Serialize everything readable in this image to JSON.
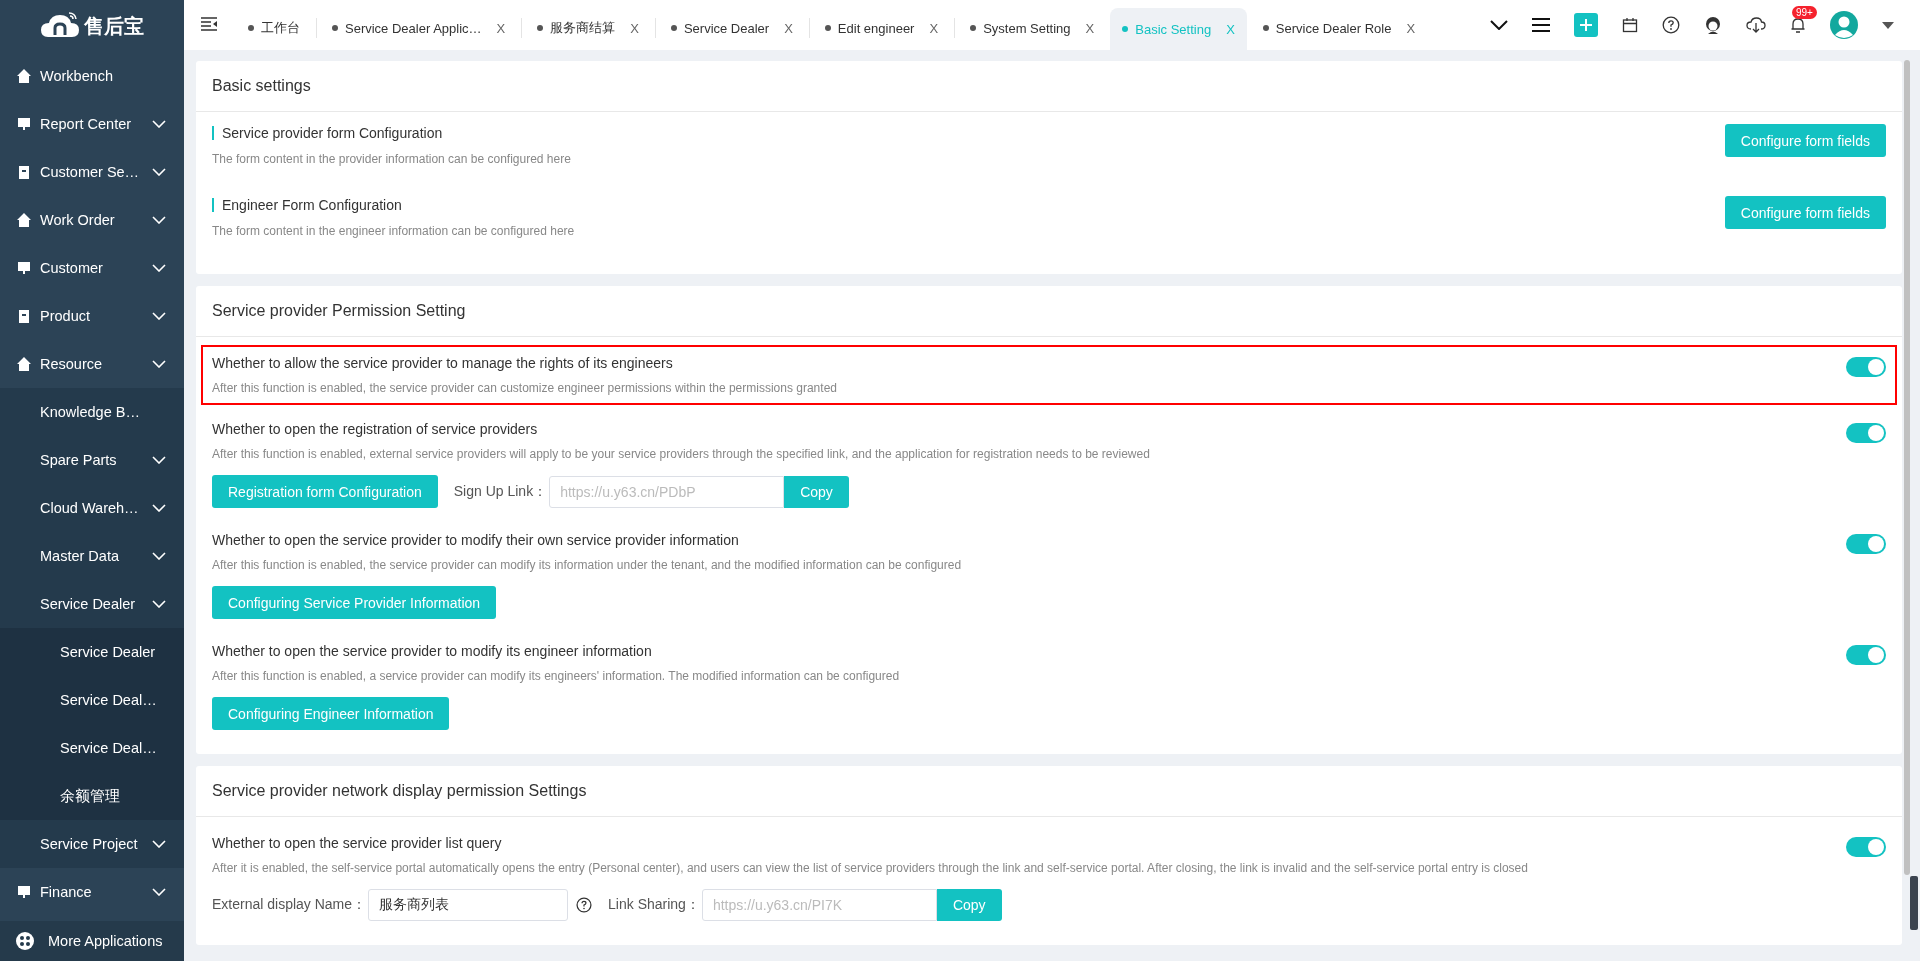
{
  "sidebar": {
    "logo_text": "售后宝",
    "items": [
      {
        "label": "Workbench"
      },
      {
        "label": "Report Center",
        "kind": "group"
      },
      {
        "label": "Customer Se…",
        "kind": "group"
      },
      {
        "label": "Work Order",
        "kind": "group"
      },
      {
        "label": "Customer",
        "kind": "group"
      },
      {
        "label": "Product",
        "kind": "group"
      },
      {
        "label": "Resource",
        "kind": "group",
        "children": [
          {
            "label": "Knowledge B…"
          },
          {
            "label": "Spare Parts",
            "kind": "group"
          },
          {
            "label": "Cloud Wareh…",
            "kind": "group"
          },
          {
            "label": "Master Data",
            "kind": "group"
          },
          {
            "label": "Service Dealer",
            "kind": "group",
            "children": [
              {
                "label": "Service Dealer"
              },
              {
                "label": "Service Deal…"
              },
              {
                "label": "Service Deal…"
              },
              {
                "label": "余额管理"
              }
            ]
          },
          {
            "label": "Service Project",
            "kind": "group"
          }
        ]
      },
      {
        "label": "Finance",
        "kind": "group"
      }
    ],
    "more": "More Applications"
  },
  "tabs": [
    {
      "label": "工作台",
      "selected": false
    },
    {
      "label": "Service Dealer Applic…",
      "selected": false,
      "close": "X"
    },
    {
      "label": "服务商结算",
      "selected": false,
      "close": "X"
    },
    {
      "label": "Service Dealer",
      "selected": false,
      "close": "X"
    },
    {
      "label": "Edit engineer",
      "selected": false,
      "close": "X"
    },
    {
      "label": "System Setting",
      "selected": false,
      "close": "X"
    },
    {
      "label": "Basic Setting",
      "selected": true,
      "close": "X"
    },
    {
      "label": "Service Dealer Role",
      "selected": false,
      "close": "X"
    }
  ],
  "notification_badge": "99+",
  "cards": [
    {
      "title": "Basic settings",
      "rows": [
        {
          "kind": "config",
          "title": "Service provider form Configuration",
          "description": "The form content in the provider information can be configured here",
          "button": "Configure form fields"
        },
        {
          "kind": "config",
          "title": "Engineer Form Configuration",
          "description": "The form content in the engineer information can be configured here",
          "button": "Configure form fields"
        }
      ]
    },
    {
      "title": "Service provider Permission Setting",
      "rows": [
        {
          "kind": "toggle",
          "title": "Whether to allow the service provider to manage the rights of its engineers",
          "description": "After this function is enabled, the service provider can customize engineer permissions within the permissions granted",
          "on": true,
          "highlighted": true
        },
        {
          "kind": "toggle",
          "title": "Whether to open the registration of service providers",
          "description": "After this function is enabled, external service providers will apply to be your service providers through the specified link, and the application for registration needs to be reviewed",
          "on": true,
          "highlighted": false,
          "controls": [
            {
              "kind": "button",
              "label": "Registration form Configuration"
            },
            {
              "kind": "label",
              "text": "Sign Up Link："
            },
            {
              "kind": "link",
              "placeholder": "https://u.y63.cn/PDbP",
              "button": "Copy"
            }
          ]
        },
        {
          "kind": "toggle",
          "title": "Whether to open the service provider to modify their own service provider information",
          "description": "After this function is enabled, the service provider can modify its information under the tenant, and the modified information can be configured",
          "on": true,
          "highlighted": false,
          "controls": [
            {
              "kind": "button",
              "label": "Configuring Service Provider Information"
            }
          ]
        },
        {
          "kind": "toggle",
          "title": "Whether to open the service provider to modify its engineer information",
          "description": "After this function is enabled, a service provider can modify its engineers' information. The modified information can be configured",
          "on": true,
          "highlighted": false,
          "controls": [
            {
              "kind": "button",
              "label": "Configuring Engineer Information"
            }
          ]
        }
      ]
    },
    {
      "title": "Service provider network display permission Settings",
      "rows": [
        {
          "kind": "toggle",
          "title": "Whether to open the service provider list query",
          "description": "After it is enabled, the self-service portal automatically opens the entry (Personal center), and users can view the list of service providers through the link and self-service portal. After closing, the link is invalid and the self-service portal entry is closed",
          "on": true,
          "highlighted": false,
          "controls": [
            {
              "kind": "label",
              "text": "External display Name："
            },
            {
              "kind": "input",
              "value": "服务商列表"
            },
            {
              "kind": "help"
            },
            {
              "kind": "label",
              "text": "Link Sharing："
            },
            {
              "kind": "link",
              "placeholder": "https://u.y63.cn/PI7K",
              "button": "Copy"
            }
          ]
        }
      ]
    }
  ]
}
